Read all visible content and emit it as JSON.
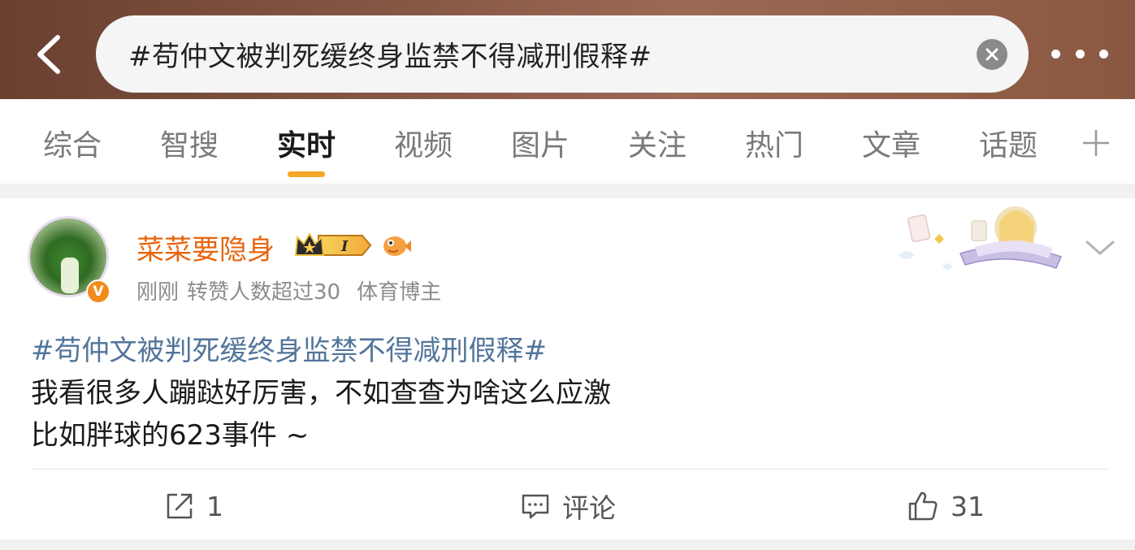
{
  "search": {
    "query": "#苟仲文被判死缓终身监禁不得减刑假释#"
  },
  "tabs": [
    {
      "label": "综合"
    },
    {
      "label": "智搜"
    },
    {
      "label": "实时"
    },
    {
      "label": "视频"
    },
    {
      "label": "图片"
    },
    {
      "label": "关注"
    },
    {
      "label": "热门"
    },
    {
      "label": "文章"
    },
    {
      "label": "话题"
    }
  ],
  "active_tab": "实时",
  "post": {
    "username": "菜菜要隐身",
    "badges": [
      "crown-level-badge",
      "fish-badge"
    ],
    "level_label": "I",
    "verified_label": "V",
    "time": "刚刚",
    "repost_note": "转赞人数超过30",
    "tag": "体育博主",
    "topic": "#苟仲文被判死缓终身监禁不得减刑假释#",
    "text_line1": "我看很多人蹦跶好厉害，不如查查为啥这么应激",
    "text_line2": "比如胖球的623事件 ~",
    "repost_count": "1",
    "comment_label": "评论",
    "like_count": "31"
  },
  "colors": {
    "accent": "#f5a623",
    "username": "#e8650e",
    "topic_link": "#52759a"
  }
}
